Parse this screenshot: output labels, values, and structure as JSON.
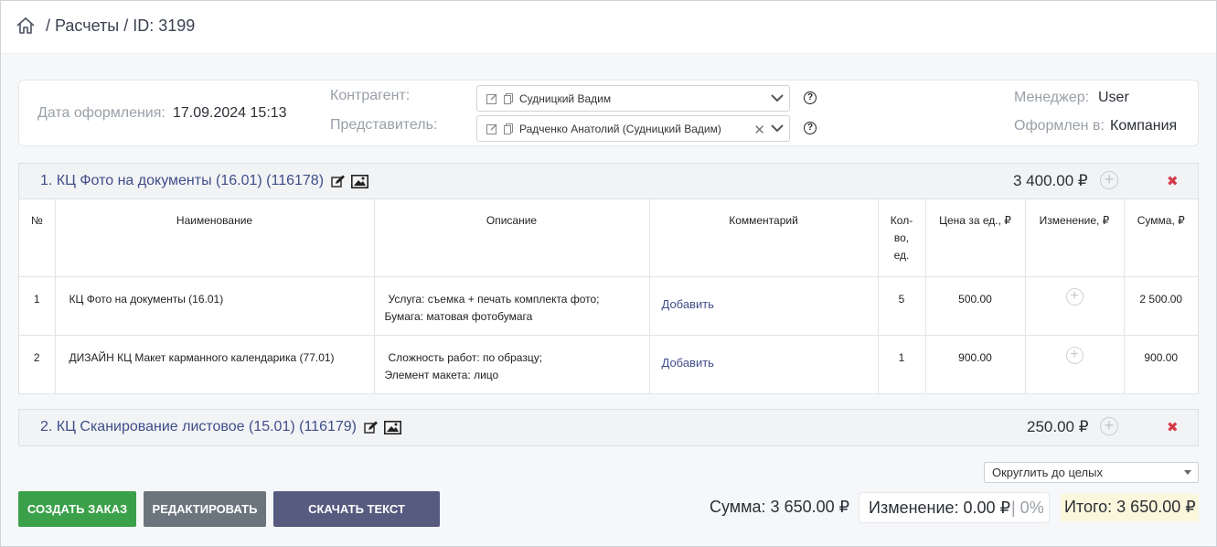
{
  "breadcrumb": {
    "section": "Расчеты",
    "id_label": "ID: 3199"
  },
  "info": {
    "date_label": "Дата оформления:",
    "date_value": "17.09.2024 15:13",
    "counterparty_label": "Контрагент:",
    "counterparty_value": "Судницкий Вадим",
    "representative_label": "Представитель:",
    "representative_value": "Радченко Анатолий (Судницкий Вадим)",
    "manager_label": "Менеджер:",
    "manager_value": "User",
    "issued_label": "Оформлен в:",
    "issued_value": "Компания",
    "help_glyph": "?"
  },
  "blocks": [
    {
      "title": "1. КЦ Фото на документы (16.01) (116178)",
      "total": "3 400.00 ₽",
      "columns": [
        "№",
        "Наименование",
        "Описание",
        "Комментарий",
        "Кол-во, ед.",
        "Цена за ед., ₽",
        "Изменение, ₽",
        "Сумма, ₽"
      ],
      "rows": [
        {
          "num": "1",
          "name": "КЦ Фото на документы (16.01)",
          "desc1": "Услуга: съемка + печать комплекта фото;",
          "desc2": "Бумага: матовая фотобумага",
          "comment": "Добавить",
          "qty": "5",
          "price": "500.00",
          "sum": "2 500.00"
        },
        {
          "num": "2",
          "name": "ДИЗАЙН КЦ Макет карманного календарика (77.01)",
          "desc1": "Сложность работ: по образцу;",
          "desc2": "Элемент макета: лицо",
          "comment": "Добавить",
          "qty": "1",
          "price": "900.00",
          "sum": "900.00"
        }
      ]
    },
    {
      "title": "2. КЦ Сканирование листовое (15.01) (116179)",
      "total": "250.00 ₽"
    }
  ],
  "rounding": {
    "selected": "Округлить до целых"
  },
  "buttons": {
    "create_order": "СОЗДАТЬ ЗАКАЗ",
    "edit": "РЕДАКТИРОВАТЬ",
    "download_text": "СКАЧАТЬ ТЕКСТ"
  },
  "totals": {
    "sum": "Сумма: 3 650.00 ₽",
    "change": "Изменение: 0.00 ₽",
    "change_pct": "| 0%",
    "itogo": "Итого: 3 650.00 ₽"
  },
  "colors": {
    "accent": "#3f4e8a",
    "create_btn": "#3aa14a",
    "edit_btn": "#6c757d",
    "download_btn": "#565b7f",
    "delete": "#d23b4a"
  }
}
